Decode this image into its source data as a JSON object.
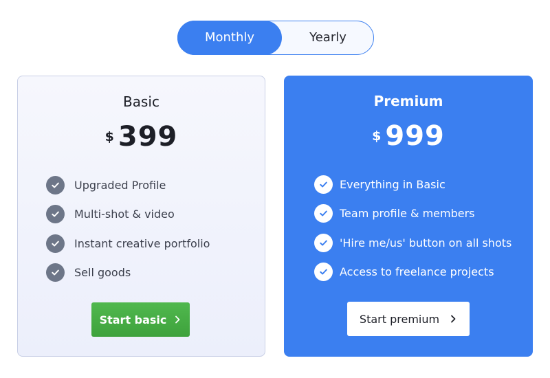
{
  "billing_toggle": {
    "monthly_label": "Monthly",
    "yearly_label": "Yearly",
    "selected": "Monthly"
  },
  "plans": [
    {
      "name": "Basic",
      "currency": "$",
      "price": "399",
      "features": [
        "Upgraded Profile",
        "Multi-shot & video",
        "Instant creative portfolio",
        "Sell goods"
      ],
      "cta_label": "Start basic"
    },
    {
      "name": "Premium",
      "currency": "$",
      "price": "999",
      "features": [
        "Everything in Basic",
        "Team profile & members",
        "'Hire me/us' button on all shots",
        "Access to freelance projects"
      ],
      "cta_label": "Start premium"
    }
  ],
  "icons": {
    "feature": "check-circle-icon",
    "cta": "chevron-right-icon"
  },
  "colors": {
    "accent_blue": "#3b7ff0",
    "basic_cta_green": "#47ad45",
    "basic_check_gray": "#6d7688"
  }
}
